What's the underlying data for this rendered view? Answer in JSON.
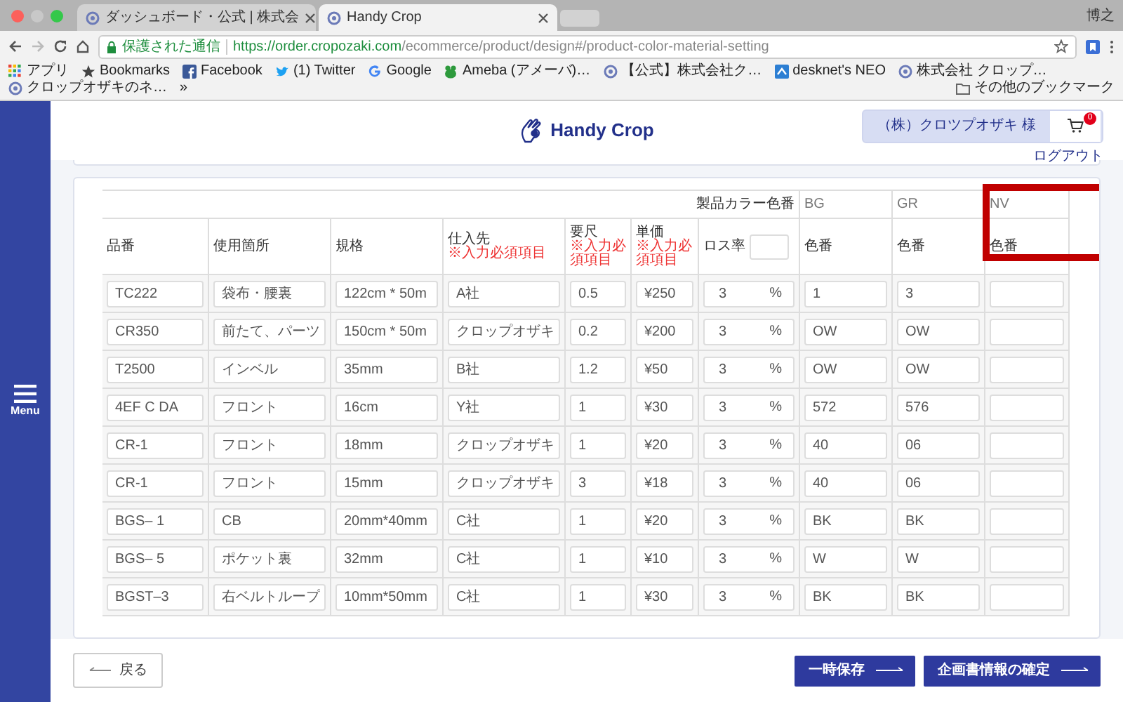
{
  "browser": {
    "tabs": [
      {
        "title": "ダッシュボード・公式 | 株式会",
        "selected": false
      },
      {
        "title": "Handy Crop",
        "selected": true
      }
    ],
    "profile": "博之",
    "secure_label": "保護された通信",
    "url_host": "https://order.cropozaki.com",
    "url_path": "/ecommerce/product/design#/product-color-material-setting",
    "bookmarks": [
      {
        "label": "アプリ",
        "kind": "apps"
      },
      {
        "label": "Bookmarks",
        "kind": "star"
      },
      {
        "label": "Facebook",
        "kind": "facebook"
      },
      {
        "label": "(1) Twitter",
        "kind": "twitter"
      },
      {
        "label": "Google",
        "kind": "google"
      },
      {
        "label": "Ameba (アメーバ)…",
        "kind": "ameba"
      },
      {
        "label": "【公式】株式会社ク…",
        "kind": "site"
      },
      {
        "label": "desknet's NEO",
        "kind": "desknets"
      },
      {
        "label": "株式会社 クロップ…",
        "kind": "site"
      },
      {
        "label": "クロップオザキのネ…",
        "kind": "site"
      },
      {
        "label": "»",
        "kind": "more"
      },
      {
        "label": "その他のブックマーク",
        "kind": "folder"
      }
    ]
  },
  "sidebar": {
    "menu_label": "Menu"
  },
  "header": {
    "logo": "Handy Crop",
    "user": "（株）クロツプオザキ 様",
    "cart_count": "0",
    "logout": "ログアウト"
  },
  "table": {
    "color_group_label": "製品カラー色番",
    "columns": [
      {
        "label": "品番",
        "kind": "plain"
      },
      {
        "label": "使用箇所",
        "kind": "plain"
      },
      {
        "label": "規格",
        "kind": "plain"
      },
      {
        "label": "仕入先",
        "kind": "required",
        "note": "※入力必須項目"
      },
      {
        "label": "要尺",
        "kind": "required",
        "note": "※入力必須項目"
      },
      {
        "label": "単価",
        "kind": "required",
        "note": "※入力必須項目"
      },
      {
        "label": "ロス率",
        "kind": "input"
      }
    ],
    "colors": [
      {
        "code": "BG",
        "label": "色番",
        "highlighted": false
      },
      {
        "code": "GR",
        "label": "色番",
        "highlighted": false
      },
      {
        "code": "NV",
        "label": "色番",
        "highlighted": true
      }
    ],
    "rows": [
      {
        "part_no": "TC222",
        "usage": "袋布・腰裏",
        "spec": "122cm * 50m",
        "supplier": "A社",
        "length": "0.5",
        "price": "¥250",
        "loss": "3",
        "loss_unit": "%",
        "colors": [
          "1",
          "3"
        ]
      },
      {
        "part_no": "CR350",
        "usage": "前たて、パーツ",
        "spec": "150cm * 50m",
        "supplier": "クロップオザキ",
        "length": "0.2",
        "price": "¥200",
        "loss": "3",
        "loss_unit": "%",
        "colors": [
          "OW",
          "OW"
        ]
      },
      {
        "part_no": "T2500",
        "usage": "インベル",
        "spec": "35mm",
        "supplier": "B社",
        "length": "1.2",
        "price": "¥50",
        "loss": "3",
        "loss_unit": "%",
        "colors": [
          "OW",
          "OW"
        ]
      },
      {
        "part_no": "4EF C DA",
        "usage": "フロント",
        "spec": "16cm",
        "supplier": "Y社",
        "length": "1",
        "price": "¥30",
        "loss": "3",
        "loss_unit": "%",
        "colors": [
          "572",
          "576"
        ]
      },
      {
        "part_no": "CR-1",
        "usage": "フロント",
        "spec": "18mm",
        "supplier": "クロップオザキ",
        "length": "1",
        "price": "¥20",
        "loss": "3",
        "loss_unit": "%",
        "colors": [
          "40",
          "06"
        ]
      },
      {
        "part_no": "CR-1",
        "usage": "フロント",
        "spec": "15mm",
        "supplier": "クロップオザキ",
        "length": "3",
        "price": "¥18",
        "loss": "3",
        "loss_unit": "%",
        "colors": [
          "40",
          "06"
        ]
      },
      {
        "part_no": "BGS– 1",
        "usage": "CB",
        "spec": "20mm*40mm",
        "supplier": "C社",
        "length": "1",
        "price": "¥20",
        "loss": "3",
        "loss_unit": "%",
        "colors": [
          "BK",
          "BK"
        ]
      },
      {
        "part_no": "BGS– 5",
        "usage": "ポケット裏",
        "spec": "32mm",
        "supplier": "C社",
        "length": "1",
        "price": "¥10",
        "loss": "3",
        "loss_unit": "%",
        "colors": [
          "W",
          "W"
        ]
      },
      {
        "part_no": "BGST–3",
        "usage": "右ベルトループ",
        "spec": "10mm*50mm",
        "supplier": "C社",
        "length": "1",
        "price": "¥30",
        "loss": "3",
        "loss_unit": "%",
        "colors": [
          "BK",
          "BK"
        ]
      }
    ]
  },
  "footer": {
    "back": "戻る",
    "save": "一時保存",
    "confirm": "企画書情報の確定"
  }
}
